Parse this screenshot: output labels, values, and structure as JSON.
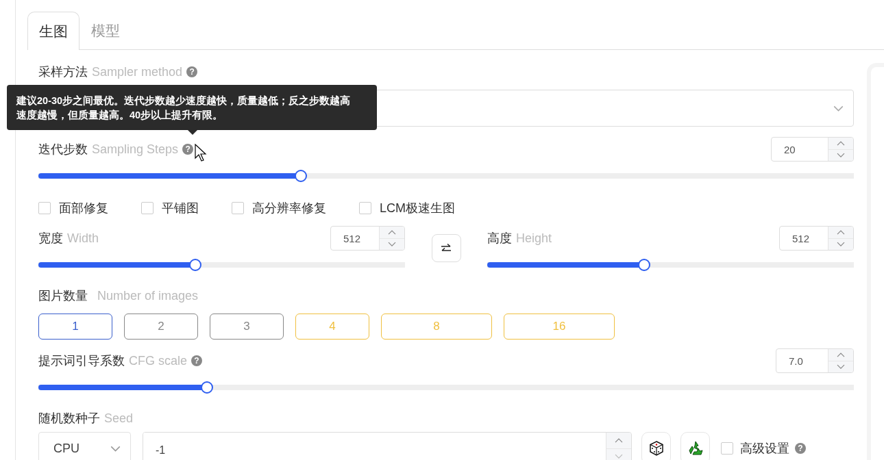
{
  "tabs": [
    {
      "label": "生图",
      "selected": true
    },
    {
      "label": "模型",
      "selected": false
    }
  ],
  "sampler": {
    "label": "采样方法",
    "label_en": "Sampler method",
    "help": "?"
  },
  "tooltip": {
    "text": "建议20-30步之间最优。迭代步数越少速度越快，质量越低；反之步数越高速度越慢，但质量越高。40步以上提升有限。"
  },
  "steps": {
    "label": "迭代步数",
    "label_en": "Sampling Steps",
    "help": "?",
    "value": "20",
    "level": 0.322
  },
  "options": [
    {
      "label": "面部修复",
      "checked": false
    },
    {
      "label": "平铺图",
      "checked": false
    },
    {
      "label": "高分辨率修复",
      "checked": false
    },
    {
      "label": "LCM极速生图",
      "checked": false
    }
  ],
  "width": {
    "label": "宽度",
    "label_en": "Width",
    "value": "512",
    "level": 0.428
  },
  "height": {
    "label": "高度",
    "label_en": "Height",
    "value": "512",
    "level": 0.428
  },
  "image_count": {
    "label": "图片数量",
    "label_en": "Number of images",
    "options": [
      {
        "label": "1",
        "selected": true,
        "kind": "normal",
        "wide": false
      },
      {
        "label": "2",
        "selected": false,
        "kind": "normal",
        "wide": false
      },
      {
        "label": "3",
        "selected": false,
        "kind": "normal",
        "wide": false
      },
      {
        "label": "4",
        "selected": false,
        "kind": "heavy",
        "wide": false
      },
      {
        "label": "8",
        "selected": false,
        "kind": "heavy",
        "wide": true
      },
      {
        "label": "16",
        "selected": false,
        "kind": "heavy",
        "wide": true
      }
    ]
  },
  "cfg": {
    "label": "提示词引导系数",
    "label_en": "CFG scale",
    "help": "?",
    "value": "7.0",
    "level": 0.207
  },
  "seed": {
    "label": "随机数种子",
    "label_en": "Seed",
    "device": "CPU",
    "value": "-1"
  },
  "advanced": {
    "label": "高级设置",
    "checked": false,
    "help": "?"
  }
}
